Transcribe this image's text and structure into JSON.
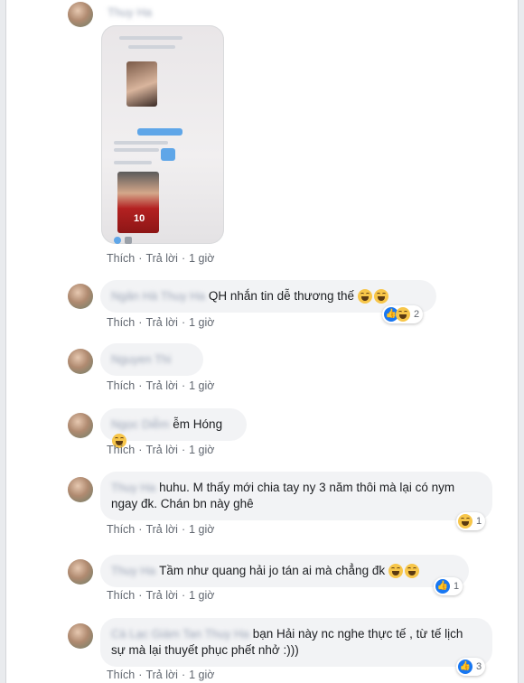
{
  "actions": {
    "like": "Thích",
    "reply": "Trả lời",
    "time": "1 giờ",
    "sep": "·"
  },
  "comments": [
    {
      "name": "Thuy Ha",
      "text": "",
      "reaction_count": ""
    },
    {
      "name": "Ngân Hà Thuy Ha",
      "text": "QH nhắn tin dễ thương thế",
      "reaction_count": "2"
    },
    {
      "name": "Nguyen Thi",
      "text": "",
      "reaction_count": ""
    },
    {
      "name": "Ngọc Diễm",
      "text": "ễm Hóng",
      "reaction_count": ""
    },
    {
      "name": "Thuy Ha",
      "text": "huhu. M thấy mới chia tay ny 3 năm thôi mà lại có nym ngay đk. Chán bn này ghê",
      "reaction_count": "1"
    },
    {
      "name": "Thuy Ha",
      "text": "Tầm như quang hải jo tán ai mà chẳng đk",
      "reaction_count": "1"
    },
    {
      "name": "Cà Lạc Giám Tan Thuy Ha",
      "text": "bạn Hải này nc nghe thực tế , từ tế lịch sự mà lại thuyết phục phết nhở :)))",
      "reaction_count": "3"
    }
  ],
  "photo": {
    "jersey_number": "10"
  }
}
